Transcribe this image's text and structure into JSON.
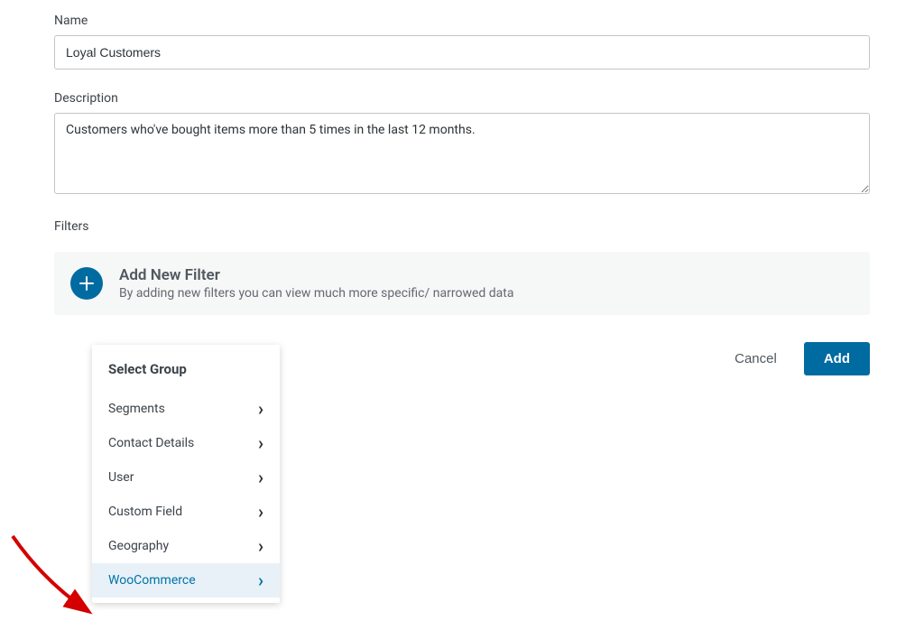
{
  "name": {
    "label": "Name",
    "value": "Loyal Customers"
  },
  "description": {
    "label": "Description",
    "value": "Customers who've bought items more than 5 times in the last 12 months."
  },
  "filters": {
    "heading": "Filters",
    "add_title": "Add New Filter",
    "add_desc": "By adding new filters you can view much more specific/ narrowed data"
  },
  "actions": {
    "cancel": "Cancel",
    "add": "Add"
  },
  "dropdown": {
    "title": "Select Group",
    "items": [
      {
        "label": "Segments",
        "highlighted": false
      },
      {
        "label": "Contact Details",
        "highlighted": false
      },
      {
        "label": "User",
        "highlighted": false
      },
      {
        "label": "Custom Field",
        "highlighted": false
      },
      {
        "label": "Geography",
        "highlighted": false
      },
      {
        "label": "WooCommerce",
        "highlighted": true
      }
    ]
  }
}
